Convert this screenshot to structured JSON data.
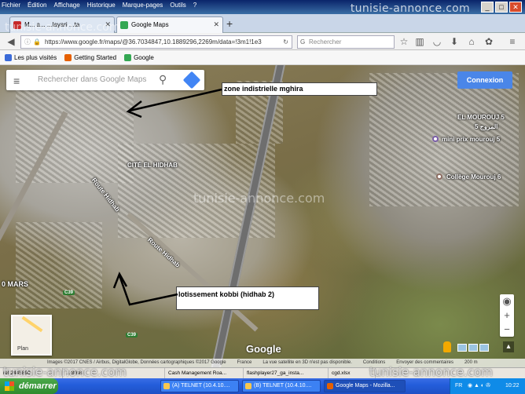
{
  "window": {
    "menu": [
      "Fichier",
      "Édition",
      "Affichage",
      "Historique",
      "Marque-pages",
      "Outils",
      "?"
    ],
    "watermark": "tunisie-annonce.com"
  },
  "tabs": [
    {
      "label": "M...  a...  ...layari ...ta",
      "active": false,
      "color": "#c62828"
    },
    {
      "label": "Google Maps",
      "active": true,
      "color": "#34a853"
    }
  ],
  "nav": {
    "url": "https://www.google.fr/maps/@36.7034847,10.1889296,2269m/data=!3m1!1e3",
    "search_placeholder": "Rechercher"
  },
  "bookmarks": [
    {
      "label": "Les plus visités",
      "color": "#3b6bd8"
    },
    {
      "label": "Getting Started",
      "color": "#e66000"
    },
    {
      "label": "Google",
      "color": "#34a853"
    }
  ],
  "map": {
    "search_placeholder": "Rechercher dans Google Maps",
    "connexion_label": "Connexion",
    "annotation_1": "zone indistrielle mghira",
    "annotation_2": "lotissement kobbi (hidhab 2)",
    "places": {
      "cite_hidhab": "CITÉ EL HIDHAB",
      "el mourouj": "EL MOUROUJ 5",
      "mourouj_ar": "المروج 5",
      "mini_prix": "mini prix mourouj 5",
      "college": "Collège Mourouj 6",
      "mars": "0 MARS",
      "rue_1": "Route Hidhab",
      "rue_2": "Route Hidhab",
      "c39a": "C39",
      "c39b": "C39"
    },
    "watermark_mid": "tunisie-annonce.com",
    "plan_label": "Plan",
    "google_logo": "Google",
    "attribution": [
      "Images ©2017 CNES / Airbus, DigitalGlobe, Données cartographiques ©2017 Google",
      "France",
      "La vue satellite en 3D n'est pas disponible.",
      "Conditions",
      "Envoyer des commentaires",
      "200 m"
    ]
  },
  "preview_strip": [
    "ref 2445890",
    "...offres",
    "Cash Management Roa...",
    "flashplayer27_ga_insta...",
    "cgd.xlsx"
  ],
  "taskbar": {
    "start_label": "démarrer",
    "items": [
      {
        "label": "(A) TELNET (10.4.10....",
        "color": "#f9c74f",
        "active": false
      },
      {
        "label": "(B) TELNET (10.4.10....",
        "color": "#f9c74f",
        "active": false
      },
      {
        "label": "Google Maps - Mozilla...",
        "color": "#e66000",
        "active": true
      }
    ],
    "lang": "FR",
    "clock": "10:22"
  }
}
